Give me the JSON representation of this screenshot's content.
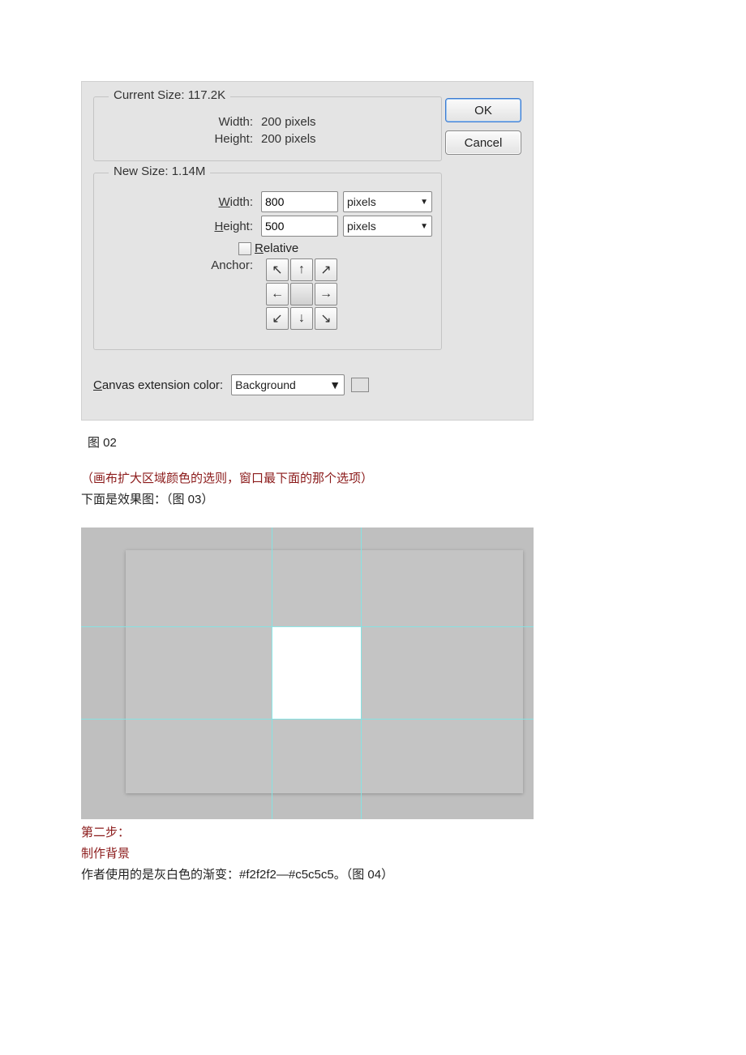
{
  "dialog": {
    "current_size": {
      "title": "Current Size: 117.2K",
      "width_label": "Width:",
      "width_value": "200 pixels",
      "height_label": "Height:",
      "height_value": "200 pixels"
    },
    "new_size": {
      "title": "New Size: 1.14M",
      "width_label": "Width:",
      "width_underline": "W",
      "width_value": "800",
      "width_unit": "pixels",
      "height_label": "Height:",
      "height_underline": "H",
      "height_value": "500",
      "height_unit": "pixels",
      "relative_label": "Relative",
      "relative_underline": "R",
      "anchor_label": "Anchor:"
    },
    "extension": {
      "label": "Canvas extension color:",
      "label_underline": "C",
      "value": "Background"
    },
    "buttons": {
      "ok": "OK",
      "cancel": "Cancel"
    }
  },
  "captions": {
    "fig02": "图 02",
    "note": "（画布扩大区域颜色的选则，窗口最下面的那个选项）",
    "result_line": "下面是效果图：（图 03）",
    "step2": "第二步：",
    "step2_title": "制作背景",
    "gradient_line": "作者使用的是灰白色的渐变：#f2f2f2—#c5c5c5。（图 04）"
  }
}
